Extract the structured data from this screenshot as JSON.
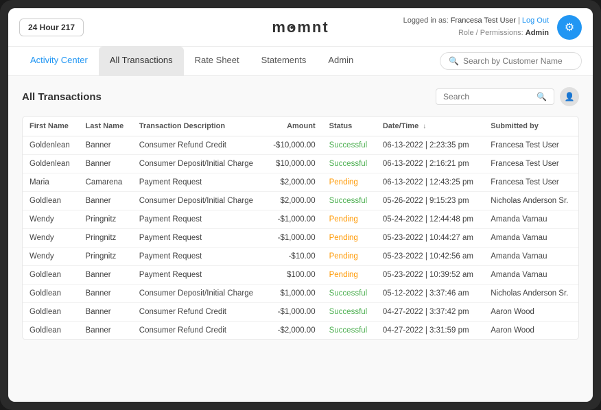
{
  "header": {
    "store": "24 Hour 217",
    "logo": "momnt",
    "user_logged_in_label": "Logged in as:",
    "user_name": "Francesa Test User",
    "logout_label": "Log Out",
    "role_label": "Role / Permissions:",
    "role_value": "Admin",
    "settings_icon": "gear-icon"
  },
  "nav": {
    "items": [
      {
        "label": "Activity Center",
        "active": false,
        "blue": true
      },
      {
        "label": "All Transactions",
        "active": true,
        "blue": false
      },
      {
        "label": "Rate Sheet",
        "active": false,
        "blue": false
      },
      {
        "label": "Statements",
        "active": false,
        "blue": false
      },
      {
        "label": "Admin",
        "active": false,
        "blue": false
      }
    ],
    "search_placeholder": "Search by Customer Name"
  },
  "main": {
    "section_title": "All Transactions",
    "table_search_placeholder": "Search",
    "columns": [
      "First Name",
      "Last Name",
      "Transaction Description",
      "Amount",
      "Status",
      "Date/Time",
      "Submitted by"
    ],
    "rows": [
      {
        "first_name": "Goldenlean",
        "last_name": "Banner",
        "description": "Consumer Refund Credit",
        "amount": "-$10,000.00",
        "status": "Successful",
        "datetime": "06-13-2022 | 2:23:35 pm",
        "submitted_by": "Francesa Test User"
      },
      {
        "first_name": "Goldenlean",
        "last_name": "Banner",
        "description": "Consumer Deposit/Initial Charge",
        "amount": "$10,000.00",
        "status": "Successful",
        "datetime": "06-13-2022 | 2:16:21 pm",
        "submitted_by": "Francesa Test User"
      },
      {
        "first_name": "Maria",
        "last_name": "Camarena",
        "description": "Payment Request",
        "amount": "$2,000.00",
        "status": "Pending",
        "datetime": "06-13-2022 | 12:43:25 pm",
        "submitted_by": "Francesa Test User"
      },
      {
        "first_name": "Goldlean",
        "last_name": "Banner",
        "description": "Consumer Deposit/Initial Charge",
        "amount": "$2,000.00",
        "status": "Successful",
        "datetime": "05-26-2022 | 9:15:23 pm",
        "submitted_by": "Nicholas Anderson Sr."
      },
      {
        "first_name": "Wendy",
        "last_name": "Pringnitz",
        "description": "Payment Request",
        "amount": "-$1,000.00",
        "status": "Pending",
        "datetime": "05-24-2022 | 12:44:48 pm",
        "submitted_by": "Amanda Varnau"
      },
      {
        "first_name": "Wendy",
        "last_name": "Pringnitz",
        "description": "Payment Request",
        "amount": "-$1,000.00",
        "status": "Pending",
        "datetime": "05-23-2022 | 10:44:27 am",
        "submitted_by": "Amanda Varnau"
      },
      {
        "first_name": "Wendy",
        "last_name": "Pringnitz",
        "description": "Payment Request",
        "amount": "-$10.00",
        "status": "Pending",
        "datetime": "05-23-2022 | 10:42:56 am",
        "submitted_by": "Amanda Varnau"
      },
      {
        "first_name": "Goldlean",
        "last_name": "Banner",
        "description": "Payment Request",
        "amount": "$100.00",
        "status": "Pending",
        "datetime": "05-23-2022 | 10:39:52 am",
        "submitted_by": "Amanda Varnau"
      },
      {
        "first_name": "Goldlean",
        "last_name": "Banner",
        "description": "Consumer Deposit/Initial Charge",
        "amount": "$1,000.00",
        "status": "Successful",
        "datetime": "05-12-2022 | 3:37:46 am",
        "submitted_by": "Nicholas Anderson Sr."
      },
      {
        "first_name": "Goldlean",
        "last_name": "Banner",
        "description": "Consumer Refund Credit",
        "amount": "-$1,000.00",
        "status": "Successful",
        "datetime": "04-27-2022 | 3:37:42 pm",
        "submitted_by": "Aaron Wood"
      },
      {
        "first_name": "Goldlean",
        "last_name": "Banner",
        "description": "Consumer Refund Credit",
        "amount": "-$2,000.00",
        "status": "Successful",
        "datetime": "04-27-2022 | 3:31:59 pm",
        "submitted_by": "Aaron Wood"
      }
    ]
  }
}
